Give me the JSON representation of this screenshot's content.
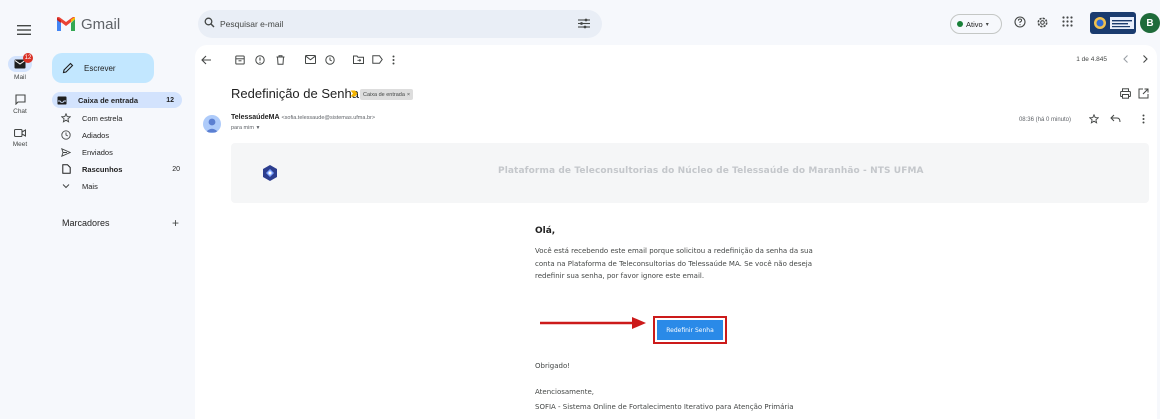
{
  "app": {
    "name": "Gmail"
  },
  "search": {
    "placeholder": "Pesquisar e-mail"
  },
  "header": {
    "status": "Ativo"
  },
  "account": {
    "initial": "B"
  },
  "rail": {
    "mail": {
      "label": "Mail",
      "badge": "12"
    },
    "chat": {
      "label": "Chat"
    },
    "meet": {
      "label": "Meet"
    }
  },
  "nav": {
    "compose": "Escrever",
    "items": [
      {
        "label": "Caixa de entrada",
        "count": "12"
      },
      {
        "label": "Com estrela",
        "count": ""
      },
      {
        "label": "Adiados",
        "count": ""
      },
      {
        "label": "Enviados",
        "count": ""
      },
      {
        "label": "Rascunhos",
        "count": "20"
      },
      {
        "label": "Mais",
        "count": ""
      }
    ],
    "labels_title": "Marcadores",
    "labels_add": "+"
  },
  "toolbar": {
    "pager": "1 de 4.845"
  },
  "email": {
    "subject": "Redefinição de Senha",
    "label_chip": "Caixa de entrada",
    "sender_name": "TelessaúdeMA",
    "sender_email": "<sofia.telessaude@sistemas.ufma.br>",
    "to": "para mim",
    "time": "08:36 (há 0 minuto)",
    "banner_text": "Plataforma de Teleconsultorias do Núcleo de Telessaúde do Maranhão - NTS UFMA",
    "greeting": "Olá,",
    "paragraph": "Você está recebendo este email porque solicitou a redefinição da senha da sua conta na Plataforma de Teleconsultorias do Telessaúde MA. Se você não deseja redefinir sua senha, por favor ignore este email.",
    "button": "Redefinir Senha",
    "thanks": "Obrigado!",
    "regards": "Atenciosamente,",
    "signature": "SOFIA - Sistema Online de Fortalecimento Iterativo para Atenção Primária"
  },
  "colors": {
    "annotation_red": "#cc1a1a",
    "button_blue": "#2a8ae8",
    "compose_bg": "#c2e7ff",
    "active_nav_bg": "#d3e3fd",
    "status_green": "#188038"
  }
}
